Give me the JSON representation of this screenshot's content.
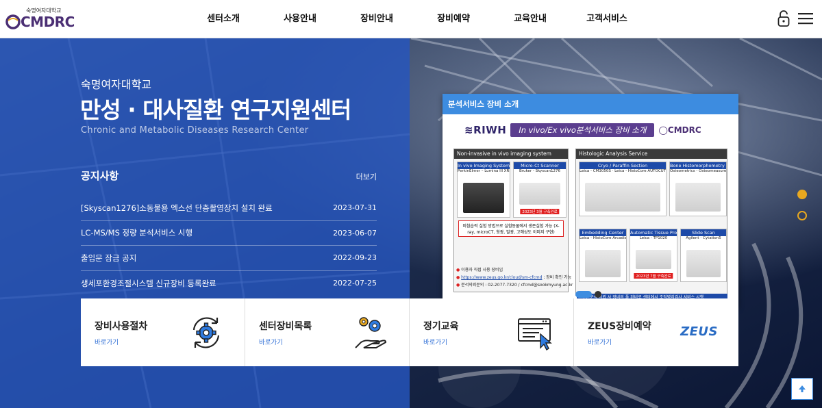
{
  "header": {
    "logo_small": "숙명여자대학교",
    "logo_main": "CMDRC",
    "nav": [
      "센터소개",
      "사용안내",
      "장비안내",
      "장비예약",
      "교육안내",
      "고객서비스"
    ]
  },
  "hero": {
    "subtitle": "숙명여자대학교",
    "title": "만성 · 대사질환 연구지원센터",
    "english": "Chronic and Metabolic Diseases Research Center"
  },
  "notice": {
    "title": "공지사항",
    "more": "더보기",
    "items": [
      {
        "text": "[Skyscan1276]소동물용 엑스선 단층촬영장치 설치 완료",
        "date": "2023-07-31"
      },
      {
        "text": "LC-MS/MS 정량 분석서비스 시행",
        "date": "2023-06-07"
      },
      {
        "text": "출입문 잠금 공지",
        "date": "2022-09-23"
      },
      {
        "text": "생세포환경조절시스템 신규장비 등록완료",
        "date": "2022-07-25"
      }
    ]
  },
  "popup": {
    "header": "분석서비스 장비 소개",
    "riwh": "RIWH",
    "band": "In vivo/Ex vivo분석서비스 장비 소개",
    "cmdrc": "CMDRC",
    "left_header": "Non-invasive in vivo imaging system",
    "right_header": "Histologic Analysis Service",
    "eq": {
      "ivis_title": "In vivo Imaging System",
      "ivis_sub": "PerkinElmer – Lumina III XRMS",
      "ct_title": "Micro-Ct Scanner",
      "ct_sub": "Bruker - Skyscan1276",
      "ct_tag": "2023년 3월 구축완료",
      "note": "비침습적 실험 방법으로 실험동물에서 생존실험 가능 (X-ray, microCT, 형광, 발광, 고해상도 이미지 구현)",
      "cryo_title": "Cryo / Paraffin Section",
      "cryo_sub": "Leica - CM3050S · Leica - HistoCore AUTOCUT",
      "bone_title": "Bone Histomorphometry analysis system",
      "bone_sub": "Osteometrics - Osteomeasure",
      "emb_title": "Embedding Center",
      "emb_sub": "Leica - HistoCore Arcadia",
      "tissue_title": "Automatic Tissue Processor",
      "tissue_sub": "Leica - TP1020",
      "tissue_tag": "2023년 7월 구축완료",
      "slide_title": "Slide Scan",
      "slide_sub": "Agilent - Cytation5"
    },
    "info_1": "이용자 직접 사용 장비임",
    "info_link": "https://www.zeus.go.kr/cloud/sm-cfcmd",
    "info_link_tail": " : 장비 확인 가능",
    "info_2": "분석의뢰문의 : 02-2077-7320 / cfcmd@sookmyung.ac.kr",
    "blue_strip": "외부 분석 의뢰 사 장비의 풀 완비로 센터에서 조직병리검사 서비스 시행"
  },
  "quick": [
    {
      "title": "장비사용절차",
      "go": "바로가기",
      "icon": "gear-cycle-icon"
    },
    {
      "title": "센터장비목록",
      "go": "바로가기",
      "icon": "hand-gears-icon"
    },
    {
      "title": "정기교육",
      "go": "바로가기",
      "icon": "browser-cursor-icon"
    },
    {
      "title": "ZEUS장비예약",
      "go": "바로가기",
      "icon": "zeus-logo",
      "logo": "ZEUS"
    }
  ],
  "colors": {
    "blue_panel": "#2655be",
    "accent": "#e8a820",
    "popup_head": "#3d8ce0",
    "brand": "#4b2f74"
  }
}
